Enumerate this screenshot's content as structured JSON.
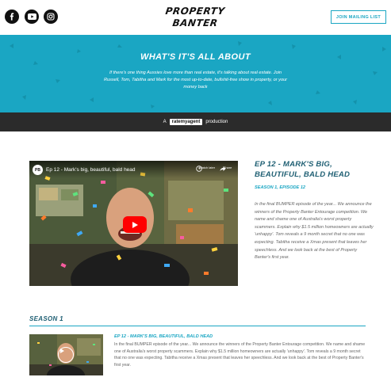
{
  "header": {
    "social": [
      {
        "name": "facebook-icon"
      },
      {
        "name": "youtube-icon"
      },
      {
        "name": "instagram-icon"
      }
    ],
    "logo_line1": "PROPERTY",
    "logo_line2": "BANTER",
    "join_label": "JOIN MAILING LIST"
  },
  "hero": {
    "title": "WHAT'S IT'S ALL ABOUT",
    "text": "If there's one thing Aussies love more than real estate, it's talking about real estate. Join Russell, Tom, Tabitha and Mark for the most up-to-date, bullshit-free show in property, or your money back",
    "background_color": "#1aa6c3"
  },
  "production_bar": {
    "prefix": "A",
    "brand": "ratemyagent",
    "suffix": "production"
  },
  "featured": {
    "video_title": "Ep 12 - Mark's big, beautiful, bald head",
    "channel_avatar_text": "PB",
    "watch_later": "Watch later",
    "share": "Share",
    "title": "EP 12 - MARK'S BIG, BEAUTIFUL, BALD HEAD",
    "subtitle": "SEASON 1, EPISODE 12",
    "description": "In the final BUMPER episode of the year... We announce the winners of the Property Banter Entourage competition. We name and shame one of Australia's worst property scammers. Explain why $1.5 million homeowners are actually 'unhappy'. Tom reveals a 9 month secret that no one was expecting. Tabitha receive a Xmas present that leaves her speechless. And we look back at the best of Property Banter's first year."
  },
  "season": {
    "title": "SEASON 1",
    "episodes": [
      {
        "title": "EP 12 - MARK'S BIG, BEAUTIFUL, BALD HEAD",
        "description": "In the final BUMPER episode of the year... We announce the winners of the Property Banter Entourage competition. We name and shame one of Australia's worst property scammers. Explain why $1.5 million homeowners are actually 'unhappy'. Tom reveals a 9 month secret that no one was expecting. Tabitha receive a Xmas present that leaves her speechless. And we look back at the best of Property Banter's first year."
      }
    ]
  },
  "colors": {
    "accent": "#1aa6c3",
    "heading": "#1f5f73",
    "dark_bar": "#2b2b2b",
    "youtube_red": "#ff0000"
  }
}
